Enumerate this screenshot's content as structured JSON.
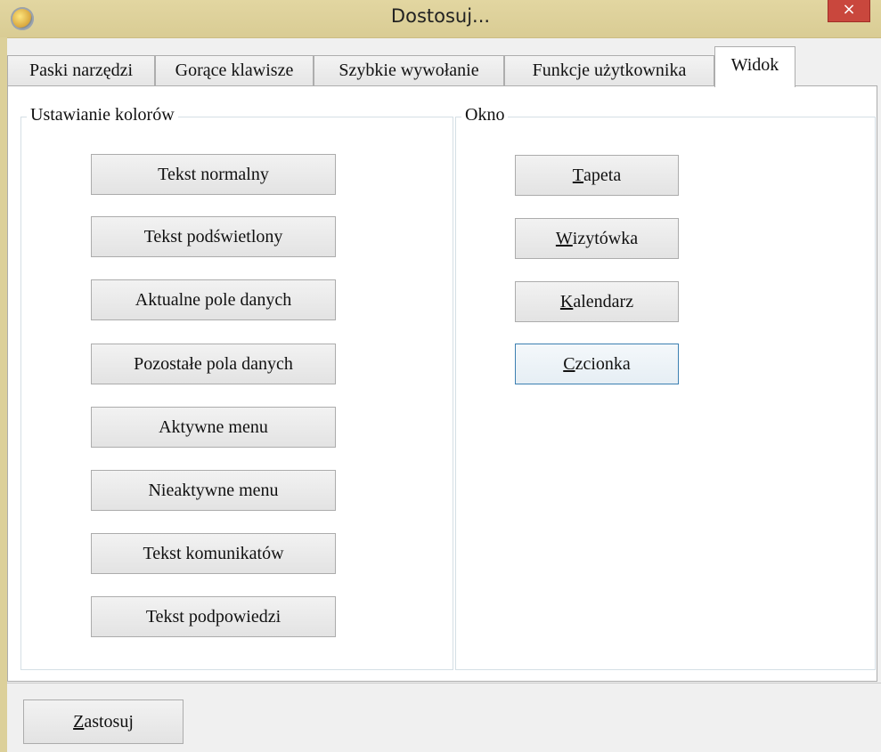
{
  "window": {
    "title": "Dostosuj...",
    "close_symbol": "×",
    "icon": "gear-icon"
  },
  "tabs": [
    {
      "label": "Paski narzędzi"
    },
    {
      "label": "Gorące klawisze"
    },
    {
      "label": "Szybkie wywołanie"
    },
    {
      "label": "Funkcje użytkownika"
    },
    {
      "label": "Widok",
      "active": true
    }
  ],
  "colors_group": {
    "label": "Ustawianie kolorów",
    "buttons": [
      {
        "label": "Tekst normalny"
      },
      {
        "label": "Tekst podświetlony"
      },
      {
        "label": "Aktualne pole danych"
      },
      {
        "label": "Pozostałe pola danych"
      },
      {
        "label": "Aktywne menu"
      },
      {
        "label": "Nieaktywne menu"
      },
      {
        "label": "Tekst komunikatów"
      },
      {
        "label": "Tekst podpowiedzi"
      }
    ]
  },
  "window_group": {
    "label": "Okno",
    "buttons": [
      {
        "accel": "T",
        "rest": "apeta"
      },
      {
        "accel": "W",
        "rest": "izytówka"
      },
      {
        "accel": "K",
        "rest": "alendarz"
      },
      {
        "accel": "C",
        "rest": "zcionka",
        "focused": true
      }
    ]
  },
  "footer": {
    "apply_accel": "Z",
    "apply_rest": "astosuj"
  },
  "colors": {
    "titlebar": "#dcd09a",
    "close": "#c9473d",
    "focus_border": "#3c7fb1"
  }
}
